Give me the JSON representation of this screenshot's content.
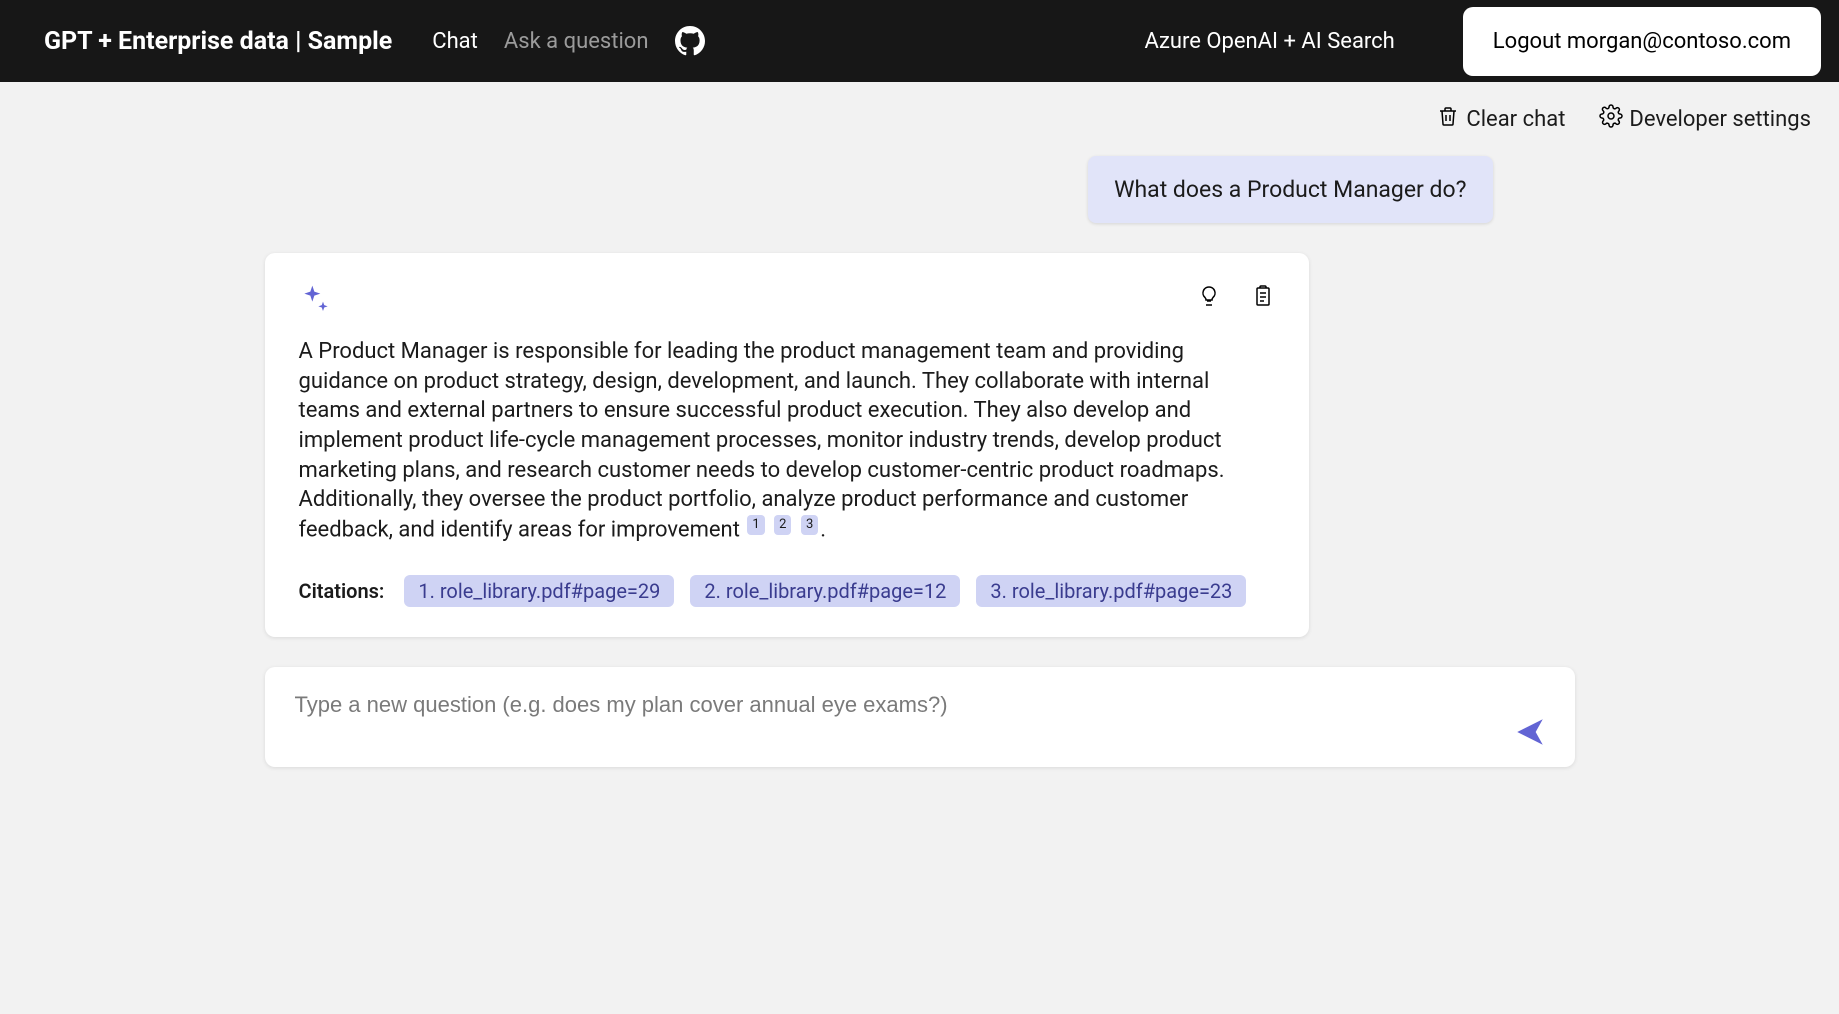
{
  "header": {
    "title": "GPT + Enterprise data | Sample",
    "nav": {
      "chat": "Chat",
      "ask": "Ask a question"
    },
    "subtitle": "Azure OpenAI + AI Search",
    "logout_label": "Logout morgan@contoso.com"
  },
  "toolbar": {
    "clear_label": "Clear chat",
    "dev_label": "Developer settings"
  },
  "chat": {
    "user_message": "What does a Product Manager do?",
    "answer": "A Product Manager is responsible for leading the product management team and providing guidance on product strategy, design, development, and launch. They collaborate with internal teams and external partners to ensure successful product execution. They also develop and implement product life-cycle management processes, monitor industry trends, develop product marketing plans, and research customer needs to develop customer-centric product roadmaps. Additionally, they oversee the product portfolio, analyze product performance and customer feedback, and identify areas for improvement",
    "inline_citations": [
      "1",
      "2",
      "3"
    ],
    "citations_label": "Citations:",
    "citations": [
      "1. role_library.pdf#page=29",
      "2. role_library.pdf#page=12",
      "3. role_library.pdf#page=23"
    ],
    "period": "."
  },
  "composer": {
    "placeholder": "Type a new question (e.g. does my plan cover annual eye exams?)",
    "value": ""
  }
}
